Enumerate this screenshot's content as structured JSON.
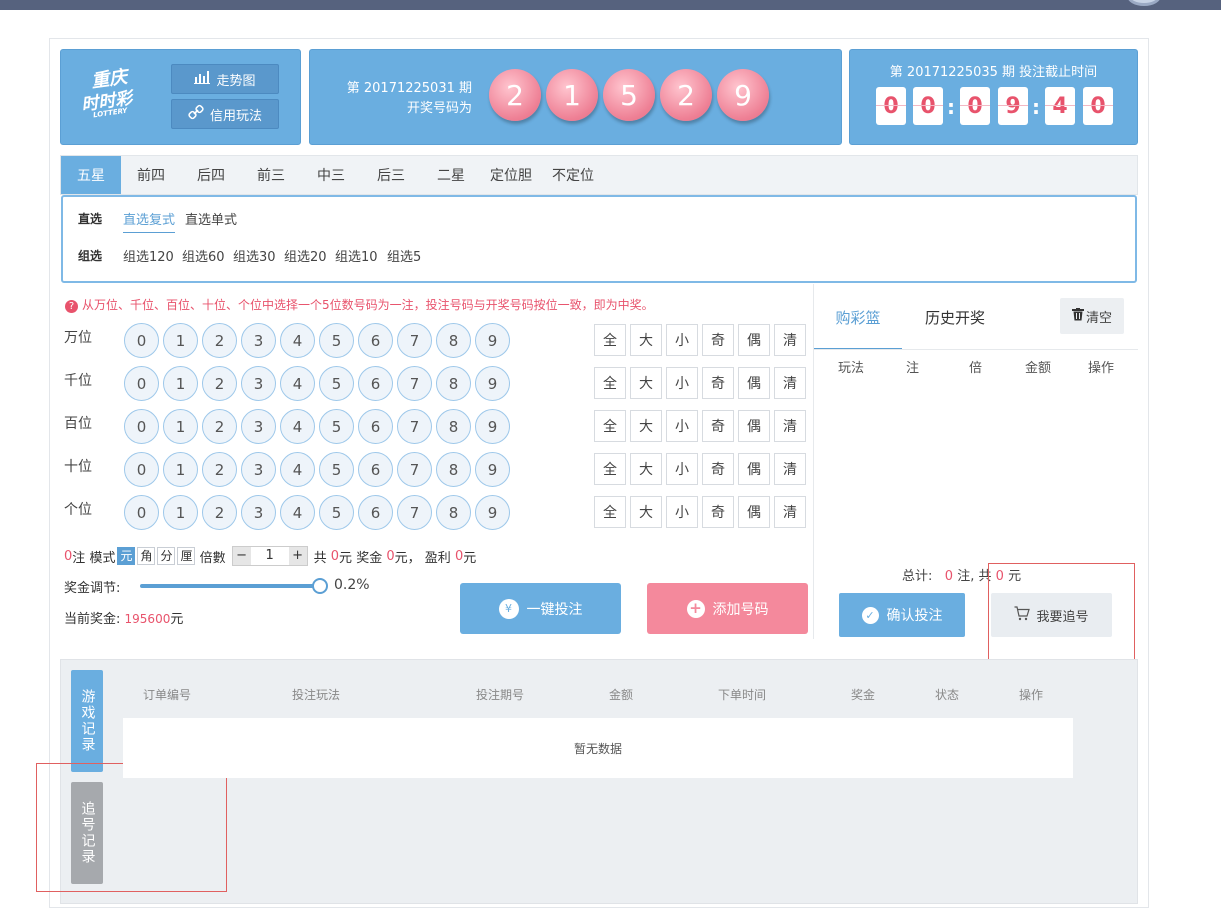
{
  "header": {
    "logo_text": [
      "重庆",
      "时时彩",
      "LOTTERY"
    ],
    "trend_label": "走势图",
    "credit_label": "信用玩法"
  },
  "draw": {
    "issue_line": "第 20171225031 期",
    "result_label": "开奖号码为",
    "numbers": [
      "2",
      "1",
      "5",
      "2",
      "9"
    ]
  },
  "countdown": {
    "title": "第 20171225035 期 投注截止时间",
    "digits": [
      "0",
      "0",
      "0",
      "9",
      "4",
      "0"
    ]
  },
  "tabs": [
    "五星",
    "前四",
    "后四",
    "前三",
    "中三",
    "后三",
    "二星",
    "定位胆",
    "不定位"
  ],
  "sub": {
    "direct_label": "直选",
    "direct_items": [
      "直选复式",
      "直选单式"
    ],
    "group_label": "组选",
    "group_items": [
      "组选120",
      "组选60",
      "组选30",
      "组选20",
      "组选10",
      "组选5"
    ]
  },
  "hint": "从万位、千位、百位、十位、个位中选择一个5位数号码为一注，投注号码与开奖号码按位一致，即为中奖。",
  "positions": [
    "万位",
    "千位",
    "百位",
    "十位",
    "个位"
  ],
  "digits": [
    "0",
    "1",
    "2",
    "3",
    "4",
    "5",
    "6",
    "7",
    "8",
    "9"
  ],
  "quick": [
    "全",
    "大",
    "小",
    "奇",
    "偶",
    "清"
  ],
  "options": {
    "count": "0",
    "count_unit": "注",
    "mode_label": "模式",
    "modes": [
      "元",
      "角",
      "分",
      "厘"
    ],
    "mult_label": "倍數",
    "mult_value": "1",
    "total_pre": "共",
    "total": "0",
    "total_unit": "元",
    "bonus_label": "奖金",
    "bonus": "0",
    "bonus_unit": "元，",
    "profit_label": "盈利",
    "profit": "0",
    "profit_unit": "元"
  },
  "adjust": {
    "label": "奖金调节:",
    "value": "0.2%",
    "level_percent": 100
  },
  "prize": {
    "label": "当前奖金:",
    "value": "195600",
    "unit": "元"
  },
  "actions": {
    "quick_bet": "一键投注",
    "add_number": "添加号码",
    "yen_glyph": "¥"
  },
  "cart": {
    "tab_cart": "购彩篮",
    "tab_history": "历史开奖",
    "clear": "清空",
    "columns": [
      "玩法",
      "注",
      "倍",
      "金额",
      "操作"
    ],
    "total_label": "总计:",
    "total_count": "0",
    "count_unit": "注,",
    "total_pre": "共",
    "total_amount": "0",
    "amount_unit": "元",
    "confirm": "确认投注",
    "chase": "我要追号"
  },
  "records": {
    "game_tab": "游戏记录",
    "chase_tab": "追号记录",
    "columns": [
      "订单编号",
      "投注玩法",
      "投注期号",
      "金额",
      "下单时间",
      "奖金",
      "状态",
      "操作"
    ],
    "empty": "暂无数据"
  },
  "colors": {
    "accent": "#6aaee0",
    "pink": "#f4899c",
    "red": "#e8536c"
  }
}
